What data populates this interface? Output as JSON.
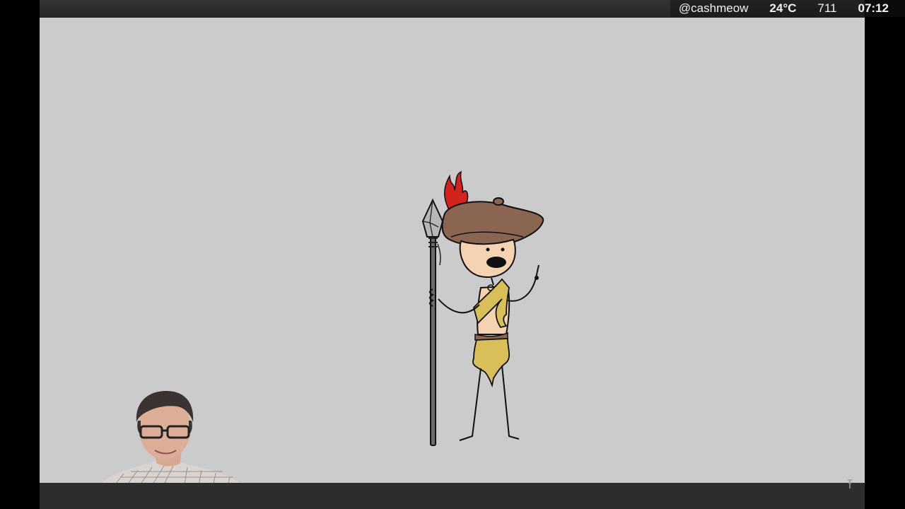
{
  "status": {
    "handle": "@cashmeow",
    "temperature": "24°C",
    "count": "711",
    "clock": "07:12"
  },
  "colors": {
    "canvas": "#cbcbcb",
    "hat": "#8a6552",
    "feather": "#d2231d",
    "skin": "#f4d2b2",
    "cloth": "#d8bf5a",
    "spear_shaft": "#6b6b6b",
    "spear_head": "#b7b7b7"
  },
  "icons": [
    "spearman-illustration",
    "webcam-feed",
    "scroll-handle-icon"
  ]
}
